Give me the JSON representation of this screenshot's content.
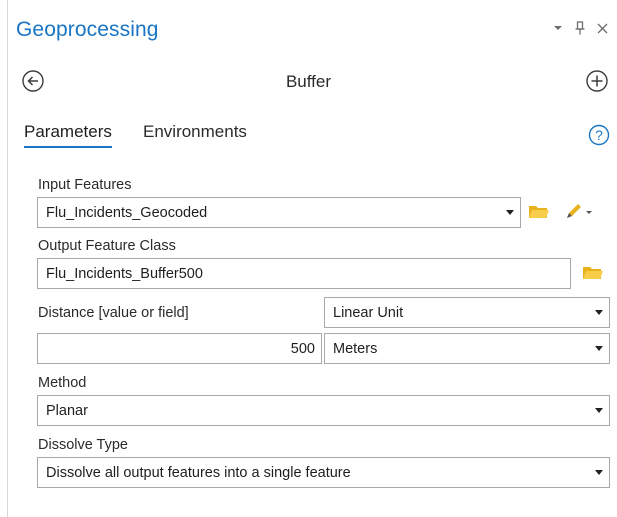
{
  "pane": {
    "title": "Geoprocessing",
    "tool_name": "Buffer"
  },
  "window_controls": {
    "menu_icon": "chevron-down-icon",
    "pin_icon": "pin-icon",
    "close_icon": "close-icon"
  },
  "nav": {
    "back_icon": "back-arrow-icon",
    "add_icon": "add-icon"
  },
  "tabs": [
    {
      "label": "Parameters",
      "active": true
    },
    {
      "label": "Environments",
      "active": false
    }
  ],
  "help_icon": "help-icon",
  "parameters": {
    "input_features": {
      "label": "Input Features",
      "value": "Flu_Incidents_Geocoded"
    },
    "output_feature_class": {
      "label": "Output Feature Class",
      "value": "Flu_Incidents_Buffer500"
    },
    "distance": {
      "label": "Distance [value or field]",
      "type_value": "Linear Unit",
      "value": "500",
      "unit": "Meters"
    },
    "method": {
      "label": "Method",
      "value": "Planar"
    },
    "dissolve_type": {
      "label": "Dissolve Type",
      "value": "Dissolve all output features into a single feature"
    }
  },
  "colors": {
    "accent": "#1a75c4",
    "folder": "#f0c419"
  }
}
